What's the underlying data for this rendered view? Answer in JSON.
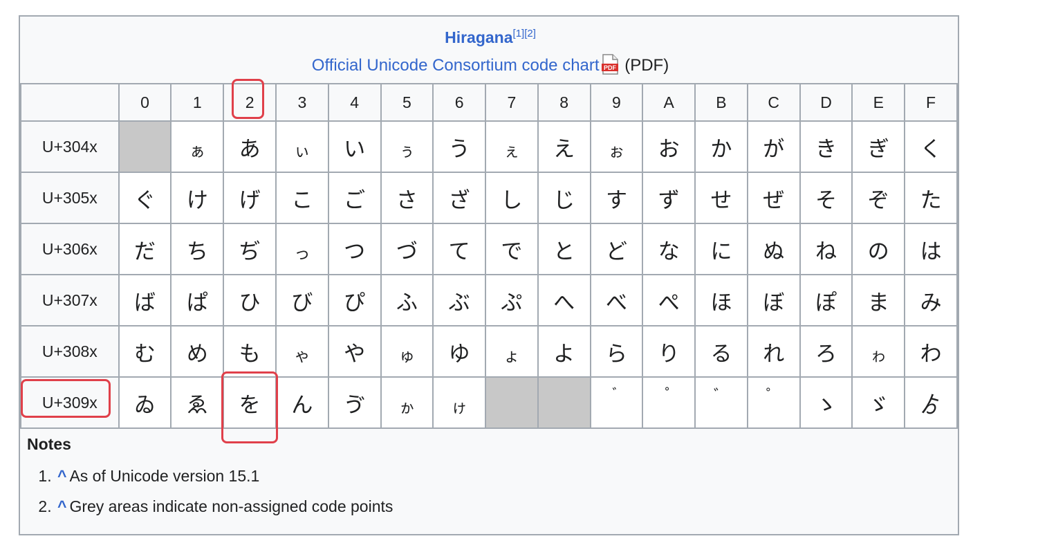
{
  "caption": {
    "title": "Hiragana",
    "title_refs": "[1][2]",
    "subtitle_link": "Official Unicode Consortium code chart",
    "subtitle_suffix": "(PDF)",
    "pdf_icon": "pdf-file-icon"
  },
  "columns": [
    "0",
    "1",
    "2",
    "3",
    "4",
    "5",
    "6",
    "7",
    "8",
    "9",
    "A",
    "B",
    "C",
    "D",
    "E",
    "F"
  ],
  "rows": [
    {
      "label": "U+304x",
      "cells": [
        "",
        "ぁ",
        "あ",
        "ぃ",
        "い",
        "ぅ",
        "う",
        "ぇ",
        "え",
        "ぉ",
        "お",
        "か",
        "が",
        "き",
        "ぎ",
        "く"
      ]
    },
    {
      "label": "U+305x",
      "cells": [
        "ぐ",
        "け",
        "げ",
        "こ",
        "ご",
        "さ",
        "ざ",
        "し",
        "じ",
        "す",
        "ず",
        "せ",
        "ぜ",
        "そ",
        "ぞ",
        "た"
      ]
    },
    {
      "label": "U+306x",
      "cells": [
        "だ",
        "ち",
        "ぢ",
        "っ",
        "つ",
        "づ",
        "て",
        "で",
        "と",
        "ど",
        "な",
        "に",
        "ぬ",
        "ね",
        "の",
        "は"
      ]
    },
    {
      "label": "U+307x",
      "cells": [
        "ば",
        "ぱ",
        "ひ",
        "び",
        "ぴ",
        "ふ",
        "ぶ",
        "ぷ",
        "へ",
        "べ",
        "ぺ",
        "ほ",
        "ぼ",
        "ぽ",
        "ま",
        "み"
      ]
    },
    {
      "label": "U+308x",
      "cells": [
        "む",
        "め",
        "も",
        "ゃ",
        "や",
        "ゅ",
        "ゆ",
        "ょ",
        "よ",
        "ら",
        "り",
        "る",
        "れ",
        "ろ",
        "ゎ",
        "わ"
      ]
    },
    {
      "label": "U+309x",
      "cells": [
        "ゐ",
        "ゑ",
        "を",
        "ん",
        "ゔ",
        "ゕ",
        "ゖ",
        "",
        "",
        "゙",
        "゚",
        "゛",
        "゜",
        "ゝ",
        "ゞ",
        "ゟ"
      ]
    }
  ],
  "small_chars": [
    "ぁ",
    "ぃ",
    "ぅ",
    "ぇ",
    "ぉ",
    "っ",
    "ゃ",
    "ゅ",
    "ょ",
    "ゎ",
    "ゕ",
    "ゖ"
  ],
  "mark_chars": [
    "゙",
    "゚",
    "゛",
    "゜"
  ],
  "notes": {
    "heading": "Notes",
    "items": [
      {
        "caret": "^",
        "text": "As of Unicode version 15.1"
      },
      {
        "caret": "^",
        "text": "Grey areas indicate non-assigned code points"
      }
    ]
  },
  "highlight_color": "#e0404a",
  "empty_cell_color": "#c8c8c8",
  "link_color": "#3366cc"
}
